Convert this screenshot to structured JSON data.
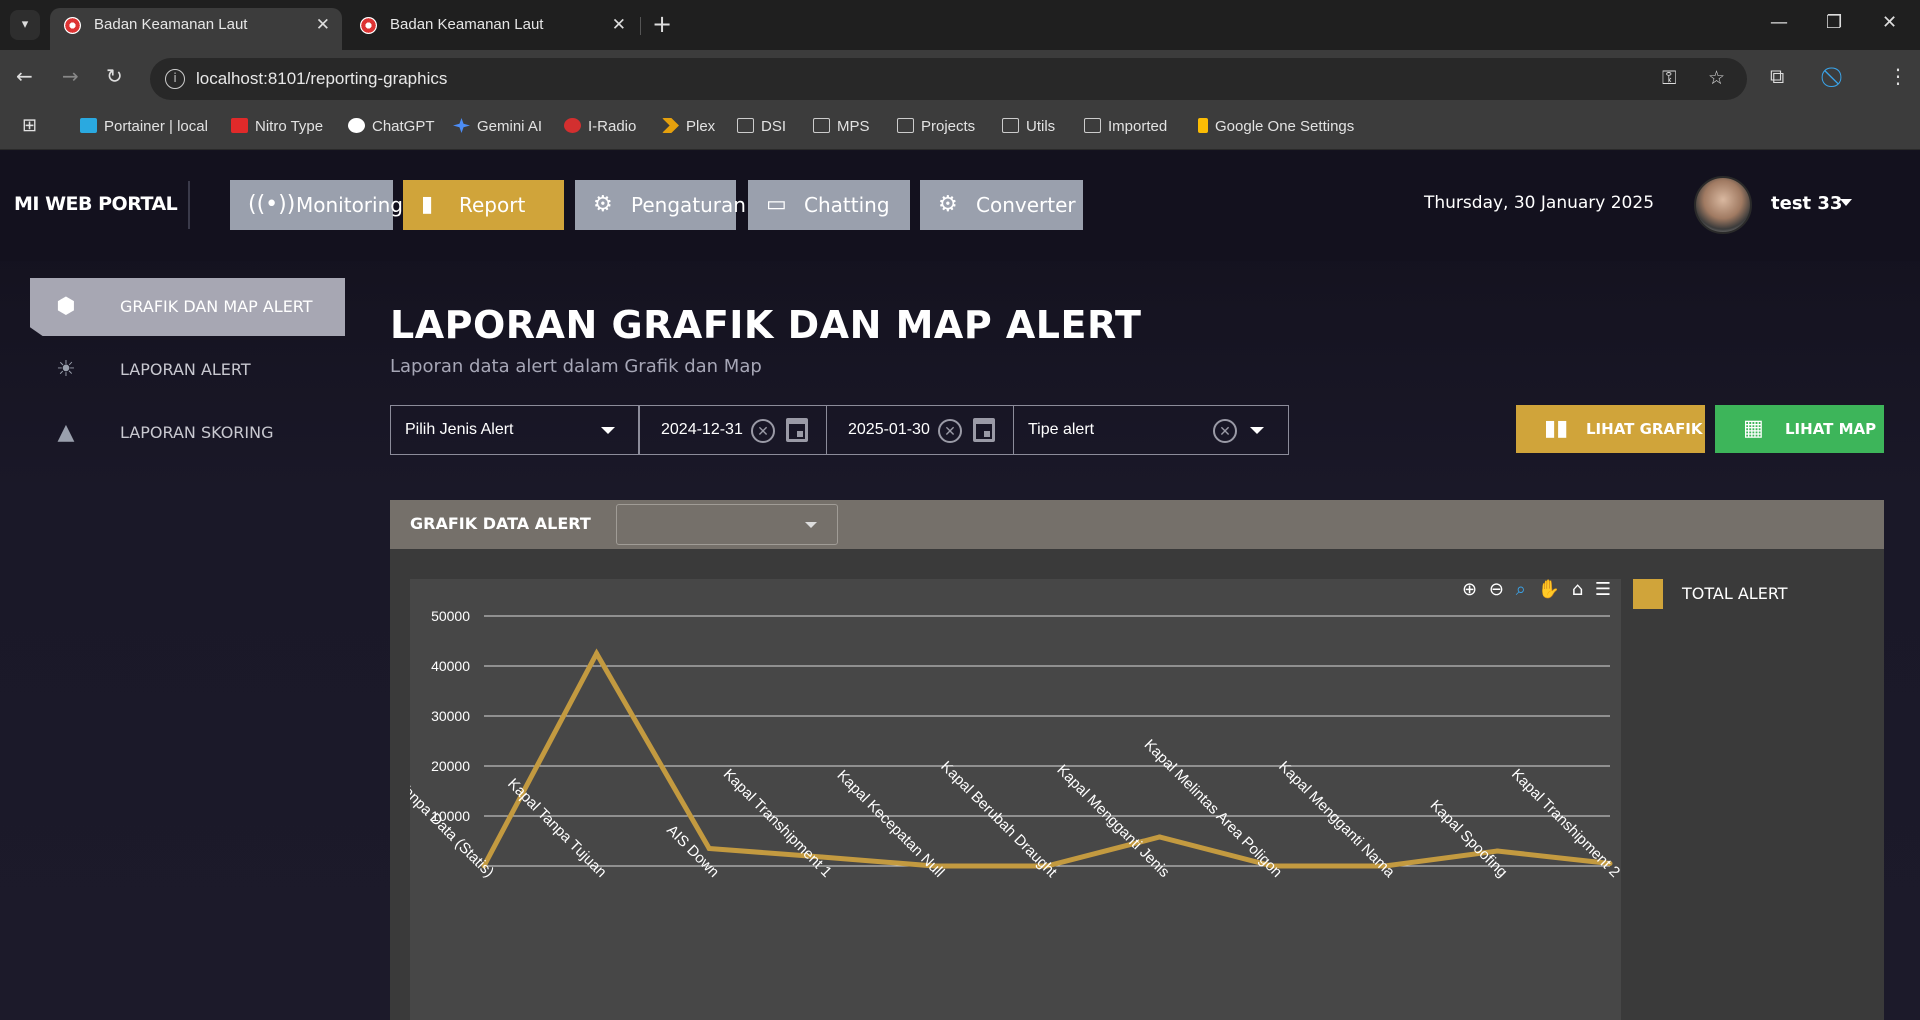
{
  "browser": {
    "tabs": [
      {
        "title": "Badan Keamanan Laut",
        "active": true
      },
      {
        "title": "Badan Keamanan Laut",
        "active": false
      }
    ],
    "url": "localhost:8101/reporting-graphics",
    "bookmarks": [
      {
        "label": "Portainer | local",
        "icon": "portainer-icon",
        "color": "#2aa9e0"
      },
      {
        "label": "Nitro Type",
        "icon": "nitro-type-icon",
        "color": "#e02a2a"
      },
      {
        "label": "ChatGPT",
        "icon": "chatgpt-icon",
        "color": "#ffffff"
      },
      {
        "label": "Gemini AI",
        "icon": "gemini-icon",
        "color": "#4c8df6"
      },
      {
        "label": "I-Radio",
        "icon": "iradio-icon",
        "color": "#d32f2f"
      },
      {
        "label": "Plex",
        "icon": "plex-icon",
        "color": "#e5a00d"
      },
      {
        "label": "DSI",
        "icon": "folder-icon"
      },
      {
        "label": "MPS",
        "icon": "folder-icon"
      },
      {
        "label": "Projects",
        "icon": "folder-icon"
      },
      {
        "label": "Utils",
        "icon": "folder-icon"
      },
      {
        "label": "Imported",
        "icon": "folder-icon"
      },
      {
        "label": "Google One Settings",
        "icon": "google-one-icon",
        "color": "#fbbc04"
      }
    ]
  },
  "header": {
    "brand": "MI WEB PORTAL",
    "nav": [
      {
        "label": "Monitoring",
        "icon": "broadcast-icon",
        "active": false
      },
      {
        "label": "Report",
        "icon": "bar-chart-icon",
        "active": true
      },
      {
        "label": "Pengaturan",
        "icon": "gear-icon",
        "active": false
      },
      {
        "label": "Chatting",
        "icon": "chat-icon",
        "active": false
      },
      {
        "label": "Converter",
        "icon": "gear-icon",
        "active": false
      }
    ],
    "date": "Thursday, 30 January 2025",
    "user": "test 33"
  },
  "sidebar": {
    "items": [
      {
        "label": "GRAFIK DAN MAP ALERT",
        "icon": "hexagon-icon",
        "active": true
      },
      {
        "label": "LAPORAN ALERT",
        "icon": "sun-icon",
        "active": false
      },
      {
        "label": "LAPORAN SKORING",
        "icon": "warning-icon",
        "active": false
      }
    ]
  },
  "main": {
    "title": "LAPORAN GRAFIK DAN MAP ALERT",
    "subtitle": "Laporan data alert dalam Grafik dan Map",
    "filters": {
      "jenis_alert_placeholder": "Pilih Jenis Alert",
      "start_date": "2024-12-31",
      "end_date": "2025-01-30",
      "tipe_alert_placeholder": "Tipe alert"
    },
    "buttons": {
      "lihat_grafik": "LIHAT GRAFIK",
      "lihat_map": "LIHAT MAP"
    },
    "colors": {
      "accent": "#d0a43a",
      "green": "#3db55a",
      "panel": "#75706a"
    },
    "panel_title": "GRAFIK DATA ALERT",
    "legend_label": "TOTAL ALERT"
  },
  "chart_data": {
    "type": "line",
    "categories": [
      "Kapal Tanpa Data (Statis)",
      "Kapal Tanpa Tujuan",
      "AIS Down",
      "Kapal Transhipment 1",
      "Kapal Kecepatan Null",
      "Kapal Berubah Draught",
      "Kapal Mengganti Jenis",
      "Kapal Melintas Area Poligon",
      "Kapal Mengganti Nama",
      "Kapal Spoofing",
      "Kapal Transhipment 2"
    ],
    "series": [
      {
        "name": "TOTAL ALERT",
        "values": [
          0,
          42500,
          3500,
          1800,
          0,
          0,
          5800,
          0,
          0,
          3000,
          500
        ]
      }
    ],
    "ylim": [
      0,
      50000
    ],
    "yticks": [
      10000,
      20000,
      30000,
      40000,
      50000
    ],
    "grid": true,
    "legend": "right",
    "color": "#c39a40"
  }
}
